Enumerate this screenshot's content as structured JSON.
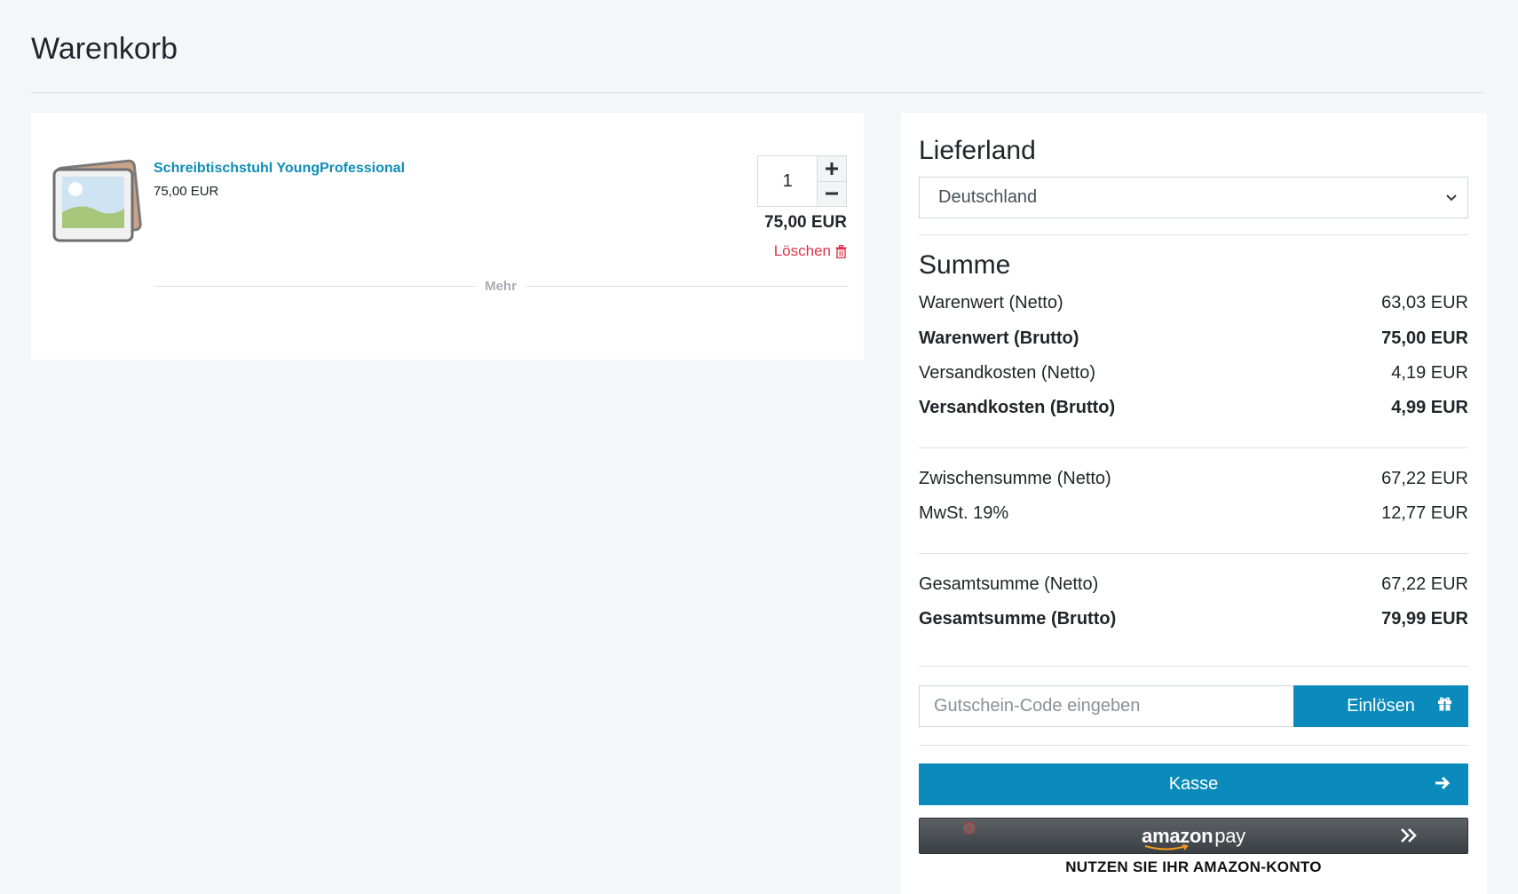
{
  "page": {
    "title": "Warenkorb"
  },
  "cart": {
    "item": {
      "name": "Schreibtischstuhl YoungProfessional",
      "unit_price": "75,00 EUR",
      "quantity": "1",
      "line_total": "75,00 EUR",
      "delete_label": "Löschen",
      "more_label": "Mehr"
    }
  },
  "summary": {
    "country_heading": "Lieferland",
    "country_selected": "Deutschland",
    "sum_heading": "Summe",
    "rows": [
      {
        "label": "Warenwert (Netto)",
        "value": "63,03 EUR"
      },
      {
        "label": "Warenwert (Brutto)",
        "value": "75,00 EUR"
      },
      {
        "label": "Versandkosten (Netto)",
        "value": "4,19 EUR"
      },
      {
        "label": "Versandkosten (Brutto)",
        "value": "4,99 EUR"
      },
      {
        "label": "Zwischensumme (Netto)",
        "value": "67,22 EUR"
      },
      {
        "label": "MwSt. 19%",
        "value": "12,77 EUR"
      },
      {
        "label": "Gesamtsumme (Netto)",
        "value": "67,22 EUR"
      },
      {
        "label": "Gesamtsumme (Brutto)",
        "value": "79,99 EUR"
      }
    ],
    "coupon_placeholder": "Gutschein-Code eingeben",
    "redeem_label": "Einlösen",
    "checkout_label": "Kasse",
    "amazon_logo": "amazon",
    "amazon_pay": "pay",
    "amazon_caption": "NUTZEN SIE IHR AMAZON-KONTO"
  },
  "colors": {
    "accent": "#0a8bbb",
    "link": "#0e8db8",
    "danger": "#e0334a"
  },
  "icons": [
    "image-placeholder-icon",
    "plus-icon",
    "minus-icon",
    "trash-icon",
    "chevron-down-icon",
    "gift-icon",
    "arrow-right-icon",
    "double-chevron-right-icon",
    "scroll-badge-icon"
  ]
}
